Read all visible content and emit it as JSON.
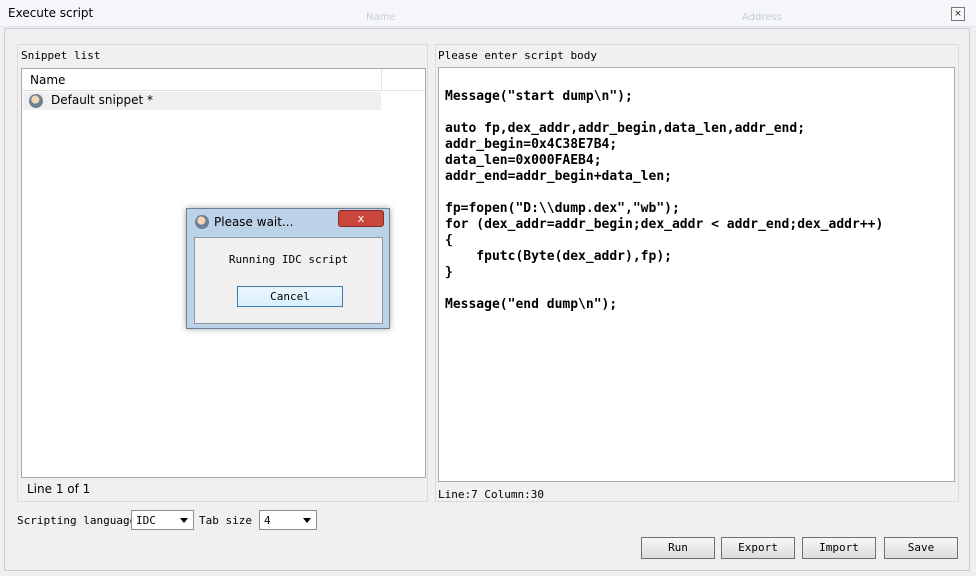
{
  "window": {
    "title": "Execute script",
    "close_icon": "×",
    "background_labels": {
      "left": "Name",
      "right": "Address"
    }
  },
  "snippet_panel": {
    "label": "Snippet list",
    "column_header": "Name",
    "items": [
      {
        "label": "Default snippet *",
        "icon": "user-avatar-icon"
      }
    ],
    "status": "Line 1 of 1"
  },
  "script_panel": {
    "label": "Please enter script body",
    "code": "Message(\"start dump\\n\");\n\nauto fp,dex_addr,addr_begin,data_len,addr_end;\naddr_begin=0x4C38E7B4;\ndata_len=0x000FAEB4;\naddr_end=addr_begin+data_len;\n\nfp=fopen(\"D:\\\\dump.dex\",\"wb\");\nfor (dex_addr=addr_begin;dex_addr < addr_end;dex_addr++)\n{\n    fputc(Byte(dex_addr),fp);\n}\n\nMessage(\"end dump\\n\");",
    "status": "Line:7  Column:30"
  },
  "bottom": {
    "scripting_language_label": "Scripting language",
    "language_value": "IDC",
    "tab_size_label": "Tab size",
    "tab_size_value": "4",
    "buttons": {
      "run": "Run",
      "export": "Export",
      "import": "Import",
      "save": "Save"
    }
  },
  "dialog": {
    "title": "Please wait...",
    "message": "Running IDC script",
    "cancel": "Cancel",
    "close_icon": "x",
    "icon": "user-avatar-icon"
  }
}
